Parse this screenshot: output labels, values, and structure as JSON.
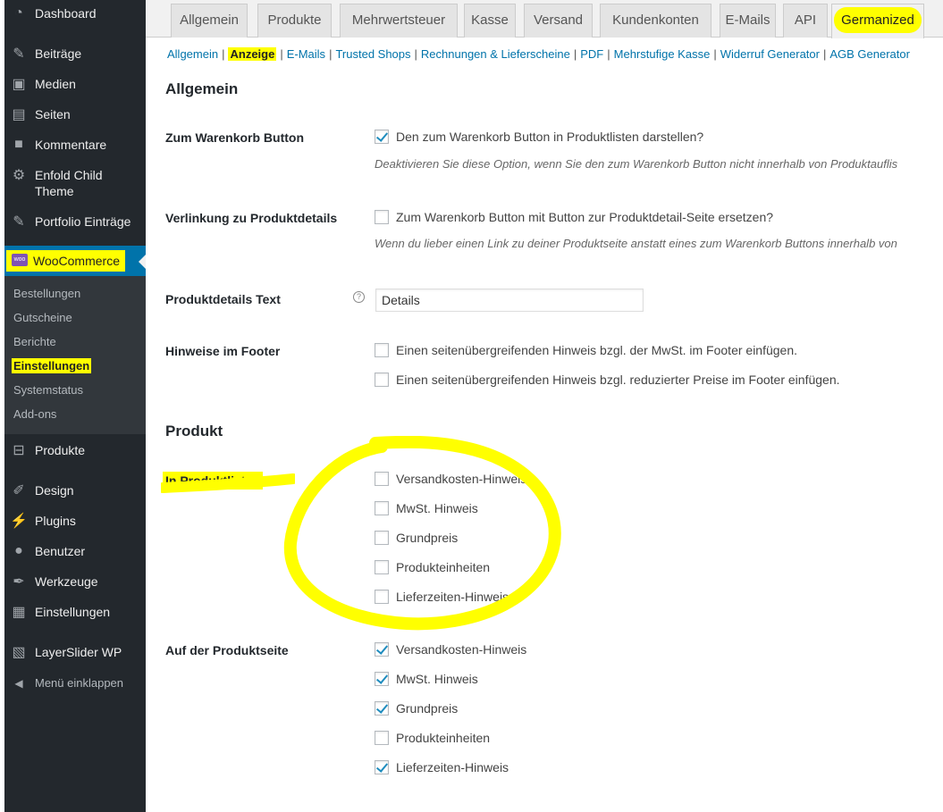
{
  "sidebar": {
    "items": [
      {
        "label": "Dashboard",
        "icon": "dashboard-icon",
        "glyph": "◔"
      },
      {
        "label": "Beiträge",
        "icon": "pin-icon",
        "glyph": "✎"
      },
      {
        "label": "Medien",
        "icon": "media-icon",
        "glyph": "▣"
      },
      {
        "label": "Seiten",
        "icon": "pages-icon",
        "glyph": "▤"
      },
      {
        "label": "Kommentare",
        "icon": "comment-icon",
        "glyph": "■"
      },
      {
        "label": "Enfold Child Theme",
        "icon": "gear-icon",
        "glyph": "⚙"
      },
      {
        "label": "Portfolio Einträge",
        "icon": "pin-icon",
        "glyph": "✎"
      },
      {
        "label": "WooCommerce",
        "icon": "woocommerce-icon",
        "glyph": "woo"
      },
      {
        "label": "Produkte",
        "icon": "cart-icon",
        "glyph": "⊟"
      },
      {
        "label": "Design",
        "icon": "brush-icon",
        "glyph": "✐"
      },
      {
        "label": "Plugins",
        "icon": "plugin-icon",
        "glyph": "⚡"
      },
      {
        "label": "Benutzer",
        "icon": "user-icon",
        "glyph": "●"
      },
      {
        "label": "Werkzeuge",
        "icon": "wrench-icon",
        "glyph": "✒"
      },
      {
        "label": "Einstellungen",
        "icon": "settings-icon",
        "glyph": "▦"
      },
      {
        "label": "LayerSlider WP",
        "icon": "layers-icon",
        "glyph": "▧"
      },
      {
        "label": "Menü einklappen",
        "icon": "collapse-icon",
        "glyph": "◀"
      }
    ],
    "submenu": [
      "Bestellungen",
      "Gutscheine",
      "Berichte",
      "Einstellungen",
      "Systemstatus",
      "Add-ons"
    ]
  },
  "tabs": [
    "Allgemein",
    "Produkte",
    "Mehrwertsteuer",
    "Kasse",
    "Versand",
    "Kundenkonten",
    "E-Mails",
    "API",
    "Germanized"
  ],
  "subsub": [
    "Allgemein",
    "Anzeige",
    "E-Mails",
    "Trusted Shops",
    "Rechnungen & Lieferscheine",
    "PDF",
    "Mehrstufige Kasse",
    "Widerruf Generator",
    "AGB Generator"
  ],
  "sections": {
    "allgemein": "Allgemein",
    "produkt": "Produkt"
  },
  "settings": {
    "warenkorb": {
      "label": "Zum Warenkorb Button",
      "checkbox": "Den zum Warenkorb Button in Produktlisten darstellen?",
      "checked": true,
      "desc": "Deaktivieren Sie diese Option, wenn Sie den zum Warenkorb Button nicht innerhalb von Produktauflis"
    },
    "verlinkung": {
      "label": "Verlinkung zu Produktdetails",
      "checkbox": "Zum Warenkorb Button mit Button zur Produktdetail-Seite ersetzen?",
      "checked": false,
      "desc": "Wenn du lieber einen Link zu deiner Produktseite anstatt eines zum Warenkorb Buttons innerhalb von"
    },
    "details_text": {
      "label": "Produktdetails Text",
      "help": "?",
      "value": "Details"
    },
    "footer": {
      "label": "Hinweise im Footer",
      "options": [
        {
          "text": "Einen seitenübergreifenden Hinweis bzgl. der MwSt. im Footer einfügen.",
          "checked": false
        },
        {
          "text": "Einen seitenübergreifenden Hinweis bzgl. reduzierter Preise im Footer einfügen.",
          "checked": false
        }
      ]
    },
    "produktlisten": {
      "label": "In Produktlisten",
      "options": [
        {
          "text": "Versandkosten-Hinweis",
          "checked": false
        },
        {
          "text": "MwSt. Hinweis",
          "checked": false
        },
        {
          "text": "Grundpreis",
          "checked": false
        },
        {
          "text": "Produkteinheiten",
          "checked": false
        },
        {
          "text": "Lieferzeiten-Hinweis",
          "checked": false
        }
      ]
    },
    "produktseite": {
      "label": "Auf der Produktseite",
      "options": [
        {
          "text": "Versandkosten-Hinweis",
          "checked": true
        },
        {
          "text": "MwSt. Hinweis",
          "checked": true
        },
        {
          "text": "Grundpreis",
          "checked": true
        },
        {
          "text": "Produkteinheiten",
          "checked": false
        },
        {
          "text": "Lieferzeiten-Hinweis",
          "checked": true
        }
      ]
    }
  },
  "colors": {
    "highlight": "#ffff00",
    "sidebar": "#23282d",
    "accent": "#0073aa"
  }
}
